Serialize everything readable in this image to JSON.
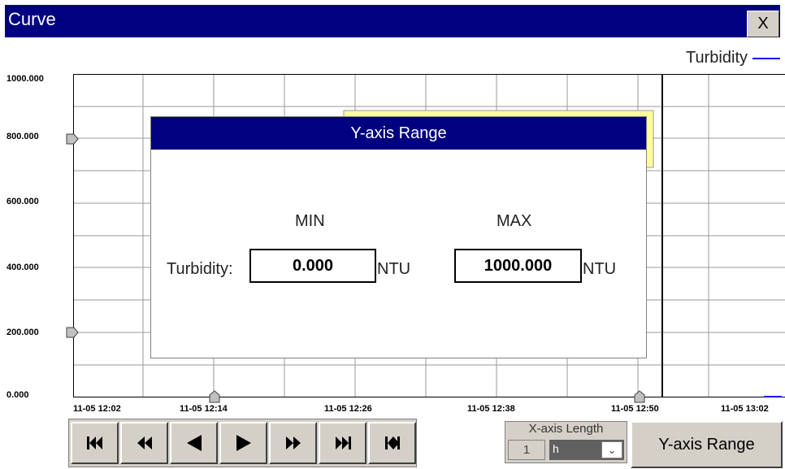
{
  "window": {
    "title": "Curve",
    "close_label": "X"
  },
  "legend": {
    "series": "Turbidity",
    "color": "#0000ff"
  },
  "chart_data": {
    "type": "line",
    "series": [
      {
        "name": "Turbidity",
        "values": []
      }
    ],
    "ylim": [
      0,
      1000
    ],
    "y_ticks": [
      "1000.000",
      "800.000",
      "600.000",
      "400.000",
      "200.000",
      "0.000"
    ],
    "x_ticks": [
      "11-05 12:02",
      "11-05 12:14",
      "11-05 12:26",
      "11-05 12:38",
      "11-05 12:50",
      "11-05 13:02"
    ],
    "grid": true
  },
  "dialog": {
    "title": "Y-axis Range",
    "min_header": "MIN",
    "max_header": "MAX",
    "row_label": "Turbidity:",
    "min_value": "0.000",
    "max_value": "1000.000",
    "unit": "NTU"
  },
  "navigation": {
    "buttons": [
      "first-icon",
      "fast-rewind-icon",
      "step-back-icon",
      "step-forward-icon",
      "fast-forward-icon",
      "last-icon",
      "reset-icon"
    ]
  },
  "x_axis_length": {
    "title": "X-axis Length",
    "value": "1",
    "unit": "h"
  },
  "y_range_button": "Y-axis Range",
  "colors": {
    "title_bar": "#000080",
    "highlight": "#ffff99"
  }
}
